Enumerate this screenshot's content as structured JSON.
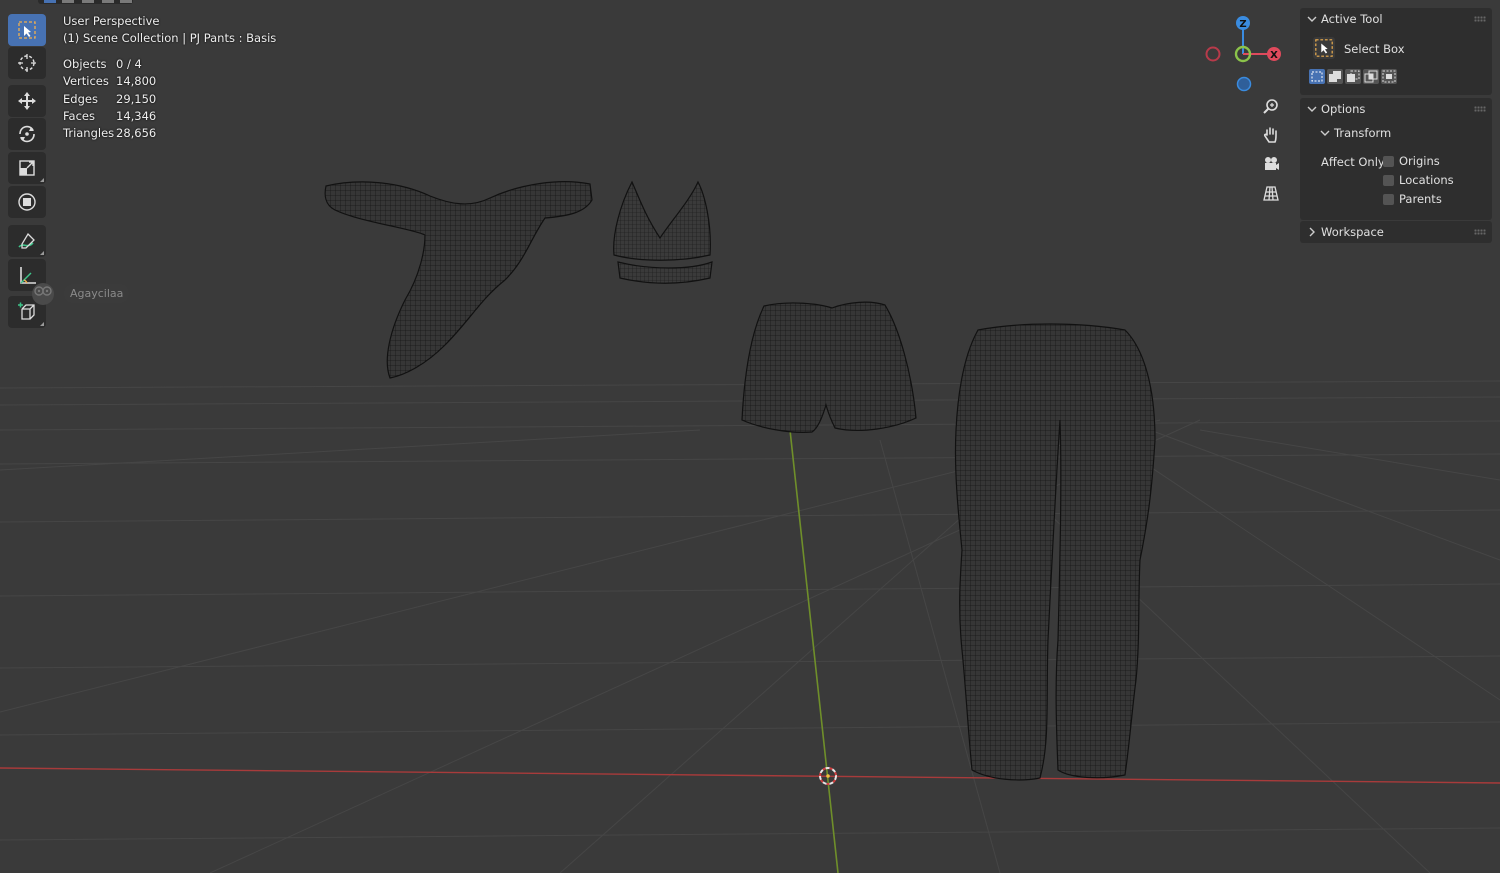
{
  "viewport": {
    "header_line1": "User Perspective",
    "header_line2": "(1) Scene Collection | PJ Pants : Basis"
  },
  "stats": [
    {
      "label": "Objects",
      "value": "0 / 4"
    },
    {
      "label": "Vertices",
      "value": "14,800"
    },
    {
      "label": "Edges",
      "value": "29,150"
    },
    {
      "label": "Faces",
      "value": "14,346"
    },
    {
      "label": "Triangles",
      "value": "28,656"
    }
  ],
  "user_tag": {
    "name": "Agaycilaa"
  },
  "toolbar": {
    "tools": [
      "select-box",
      "cursor",
      "move",
      "rotate",
      "scale",
      "transform",
      "annotate",
      "measure",
      "add-cube"
    ],
    "active": "select-box"
  },
  "gizmo": {
    "z": "Z",
    "x": "X",
    "colors": {
      "x": "#e04a5c",
      "y": "#8bc34a",
      "z": "#3a8ce0"
    }
  },
  "panel": {
    "active_tool": {
      "title": "Active Tool",
      "tool_name": "Select Box"
    },
    "options": {
      "title": "Options",
      "transform_title": "Transform",
      "affect_only_label": "Affect Only",
      "checkboxes": [
        {
          "label": "Origins",
          "checked": false
        },
        {
          "label": "Locations",
          "checked": false
        },
        {
          "label": "Parents",
          "checked": false
        }
      ]
    },
    "workspace": {
      "title": "Workspace"
    }
  },
  "colors": {
    "accent": "#4772b3",
    "x_axis": "#c84a4a",
    "y_axis": "#6a8f2a",
    "background": "#3a3a3a"
  }
}
